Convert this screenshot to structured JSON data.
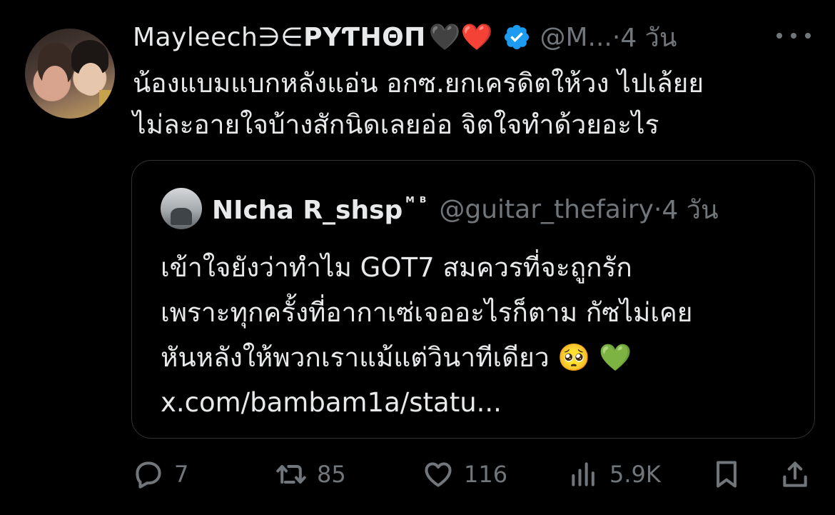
{
  "author": {
    "display_name_prefix": "Mayleech∋∈",
    "display_name_bold": "PYƬHΘП",
    "hearts": "🖤❤️",
    "handle": "@M...",
    "separator": "·",
    "time": "4 วัน"
  },
  "tweet": {
    "line1": "น้องแบมแบกหลังแอ่น อกซ.ยกเครดิตให้วง ไปเล้ยย",
    "line2": "ไม่ละอายใจบ้างสักนิดเลยอ่อ จิตใจทำด้วยอะไร"
  },
  "quote": {
    "name": "NIcha R_shsp",
    "name_sup": "ᴹ ᴮ",
    "handle": "@guitar_thefairy",
    "separator": "·",
    "time": "4 วัน",
    "line1": "เข้าใจยังว่าทำไม GOT7 สมควรที่จะถูกรัก",
    "line2": "เพราะทุกครั้งที่อากาเซ่เจออะไรก็ตาม กัซไม่เคย",
    "line3": "หันหลังให้พวกเราแม้แต่วินาทีเดียว 🥺 💚",
    "link": "x.com/bambam1a/statu..."
  },
  "actions": {
    "replies": "7",
    "reposts": "85",
    "likes": "116",
    "views": "5.9K"
  },
  "colors": {
    "background": "#000000",
    "text": "#e7e9ea",
    "secondary": "#71767b",
    "verified": "#1d9bf0",
    "border": "#2f3336"
  }
}
